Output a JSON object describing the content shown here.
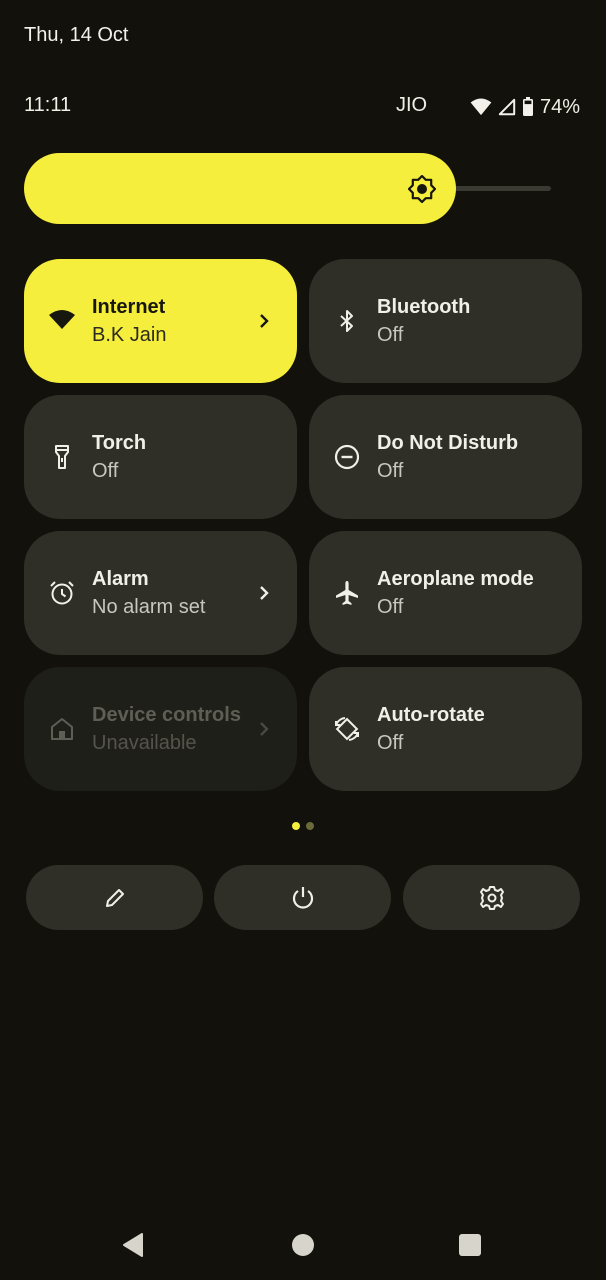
{
  "header": {
    "date": "Thu, 14 Oct"
  },
  "status_bar": {
    "time": "11:11",
    "carrier": "JIO",
    "battery_percent": "74%",
    "icons": [
      "wifi-icon",
      "cellular-signal-icon",
      "battery-icon"
    ]
  },
  "brightness": {
    "level": 0.82,
    "icon": "brightness-icon"
  },
  "colors": {
    "accent": "#f6ee3c",
    "tile": "#2f2f28",
    "background": "#12110b"
  },
  "tiles": [
    {
      "label": "Internet",
      "sub": "B.K Jain",
      "icon": "wifi-icon",
      "state": "active",
      "chevron": true
    },
    {
      "label": "Bluetooth",
      "sub": "Off",
      "icon": "bluetooth-icon",
      "state": "off",
      "chevron": false
    },
    {
      "label": "Torch",
      "sub": "Off",
      "icon": "torch-icon",
      "state": "off",
      "chevron": false
    },
    {
      "label": "Do Not Disturb",
      "sub": "Off",
      "icon": "do-not-disturb-icon",
      "state": "off",
      "chevron": false
    },
    {
      "label": "Alarm",
      "sub": "No alarm set",
      "icon": "alarm-icon",
      "state": "off",
      "chevron": true
    },
    {
      "label": "Aeroplane mode",
      "sub": "Off",
      "icon": "airplane-icon",
      "state": "off",
      "chevron": false
    },
    {
      "label": "Device controls",
      "sub": "Unavailable",
      "icon": "home-icon",
      "state": "disabled",
      "chevron": true
    },
    {
      "label": "Auto-rotate",
      "sub": "Off",
      "icon": "auto-rotate-icon",
      "state": "off",
      "chevron": false
    }
  ],
  "pager": {
    "pages": 2,
    "current": 1
  },
  "actions": [
    "edit-icon",
    "power-icon",
    "settings-icon"
  ],
  "navigation": [
    "back-icon",
    "home-icon",
    "recents-icon"
  ]
}
